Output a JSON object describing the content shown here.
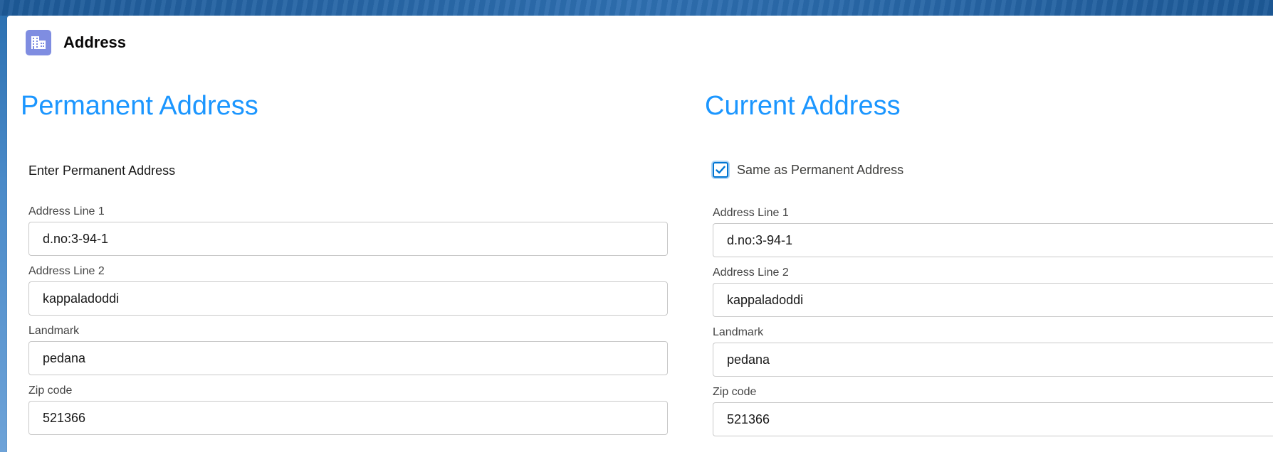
{
  "card": {
    "title": "Address",
    "icon": "building-icon",
    "icon_color": "#7f8de1"
  },
  "permanent": {
    "title": "Permanent Address",
    "intro": "Enter Permanent Address",
    "fields": [
      {
        "label": "Address Line 1",
        "value": "d.no:3-94-1"
      },
      {
        "label": "Address Line 2",
        "value": "kappaladoddi"
      },
      {
        "label": "Landmark",
        "value": "pedana"
      },
      {
        "label": "Zip code",
        "value": "521366"
      }
    ]
  },
  "current": {
    "title": "Current Address",
    "same_as_label": "Same as Permanent Address",
    "same_as_checked": true,
    "fields": [
      {
        "label": "Address Line 1",
        "value": "d.no:3-94-1"
      },
      {
        "label": "Address Line 2",
        "value": "kappaladoddi"
      },
      {
        "label": "Landmark",
        "value": "pedana"
      },
      {
        "label": "Zip code",
        "value": "521366"
      }
    ]
  },
  "colors": {
    "section_title": "#1b96ff",
    "checkbox_accent": "#0176d3"
  }
}
